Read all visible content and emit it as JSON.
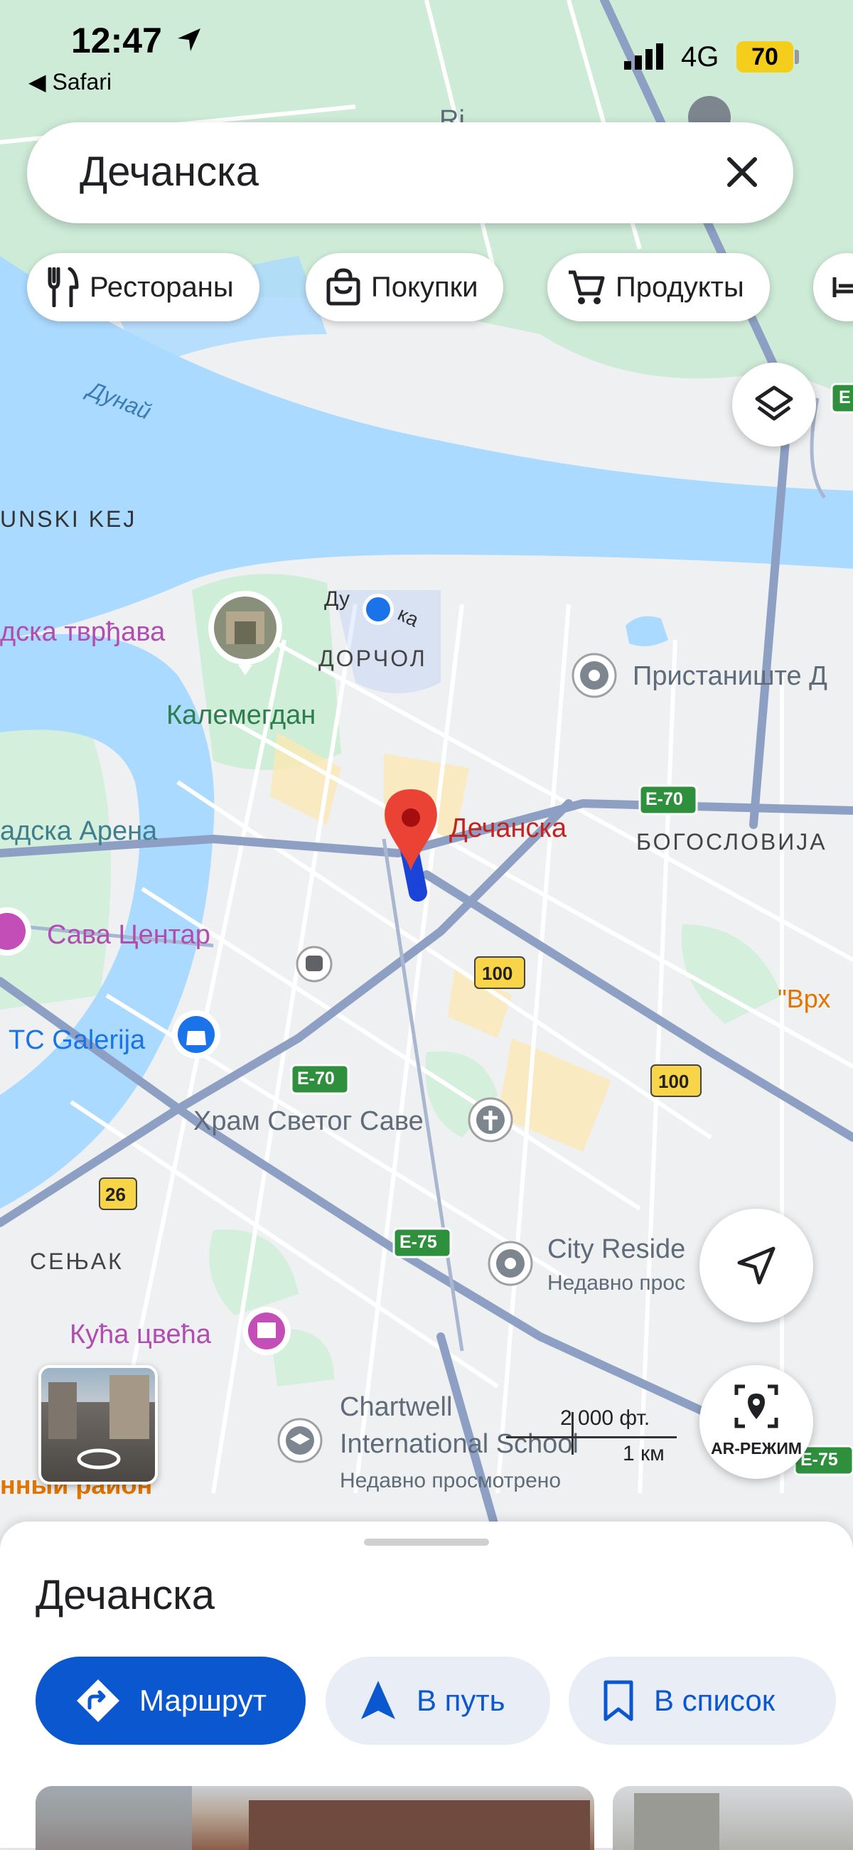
{
  "status_bar": {
    "time": "12:47",
    "back_app": "◀ Safari",
    "network": "4G",
    "battery": "70"
  },
  "search": {
    "query": "Дечанска"
  },
  "chips": [
    {
      "label": "Рестораны",
      "icon": "fork-knife-icon"
    },
    {
      "label": "Покупки",
      "icon": "shopping-bag-icon"
    },
    {
      "label": "Продукты",
      "icon": "cart-icon"
    }
  ],
  "map": {
    "river_label": "Дунай",
    "labels": {
      "unski_kej": "UNSKI KEJ",
      "tvrdjava": "дска тврђава",
      "dorcol": "ДОРЧОЛ",
      "dorcol_street": "Ду",
      "dorcol_street2": "ка",
      "pristaniste": "Пристаниште Д",
      "kalemegdan": "Калемегдан",
      "arena": "адска Арена",
      "bogoslovija": "БОГОСЛОВИЈА",
      "sava_centar": "Сава Центар",
      "vrh": "\"Врх",
      "galerija": "TC Galerija",
      "hram": "Храм Светог Саве",
      "senjak": "СЕЊАК",
      "city_reside": "City Reside",
      "recent1": "Недавно прос",
      "kuca_cveca": "Кућа цвећа",
      "chartwell1": "Chartwell",
      "chartwell2": "International School",
      "recent2": "Недавно просмотрено",
      "district": "нный район",
      "scale_ft": "2 000 фт.",
      "scale_km": "1 км",
      "top_partial": "Ri"
    },
    "pin_label": "Дечанска",
    "roads": {
      "e70_a": "E-70",
      "e70_b": "E-70",
      "r100_a": "100",
      "r100_b": "100",
      "r26": "26",
      "e75_a": "E-75",
      "e75_b": "E-75",
      "e_top": "E"
    },
    "ar_label": "AR-РЕЖИМ"
  },
  "sheet": {
    "title": "Дечанска",
    "buttons": {
      "route": "Маршрут",
      "go": "В путь",
      "save": "В список"
    }
  },
  "colors": {
    "accent": "#0b57d0",
    "water": "#aadaff",
    "park": "#c8ead1",
    "pin": "#ea4335"
  }
}
